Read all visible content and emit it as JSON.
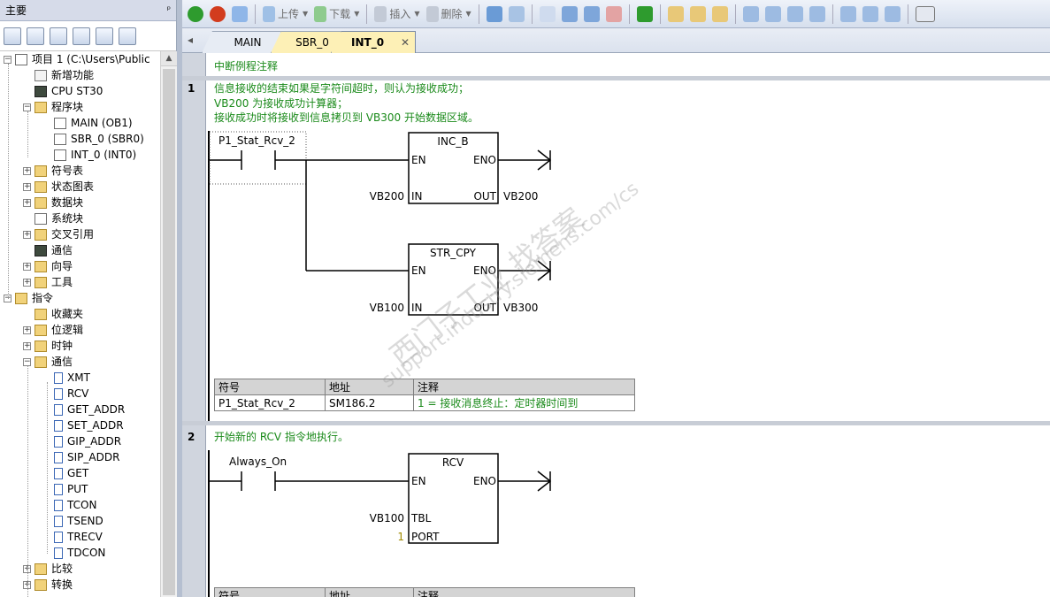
{
  "left_panel": {
    "title": "主要",
    "pin": "ᵖ",
    "tree": [
      {
        "label": "项目 1 (C:\\Users\\Public",
        "level": 0,
        "expander": "−",
        "icon": "project-icon"
      },
      {
        "label": "新增功能",
        "level": 1,
        "expander": "",
        "icon": "whats-new-icon"
      },
      {
        "label": "CPU ST30",
        "level": 1,
        "expander": "",
        "icon": "cpu-icon"
      },
      {
        "label": "程序块",
        "level": 1,
        "expander": "−",
        "icon": "folder-icon"
      },
      {
        "label": "MAIN (OB1)",
        "level": 2,
        "expander": "",
        "icon": "program-block-icon"
      },
      {
        "label": "SBR_0 (SBR0)",
        "level": 2,
        "expander": "",
        "icon": "program-block-icon"
      },
      {
        "label": "INT_0 (INT0)",
        "level": 2,
        "expander": "",
        "icon": "program-block-icon"
      },
      {
        "label": "符号表",
        "level": 1,
        "expander": "+",
        "icon": "folder-icon"
      },
      {
        "label": "状态图表",
        "level": 1,
        "expander": "+",
        "icon": "folder-icon"
      },
      {
        "label": "数据块",
        "level": 1,
        "expander": "+",
        "icon": "folder-icon"
      },
      {
        "label": "系统块",
        "level": 1,
        "expander": "",
        "icon": "system-block-icon"
      },
      {
        "label": "交叉引用",
        "level": 1,
        "expander": "+",
        "icon": "folder-icon"
      },
      {
        "label": "通信",
        "level": 1,
        "expander": "",
        "icon": "communication-icon"
      },
      {
        "label": "向导",
        "level": 1,
        "expander": "+",
        "icon": "wizard-icon"
      },
      {
        "label": "工具",
        "level": 1,
        "expander": "+",
        "icon": "folder-icon"
      },
      {
        "label": "指令",
        "level": 0,
        "expander": "−",
        "icon": "instructions-icon"
      },
      {
        "label": "收藏夹",
        "level": 1,
        "expander": "",
        "icon": "folder-icon"
      },
      {
        "label": "位逻辑",
        "level": 1,
        "expander": "+",
        "icon": "folder-icon"
      },
      {
        "label": "时钟",
        "level": 1,
        "expander": "+",
        "icon": "folder-icon"
      },
      {
        "label": "通信",
        "level": 1,
        "expander": "−",
        "icon": "folder-icon"
      },
      {
        "label": "XMT",
        "level": 2,
        "expander": "",
        "icon": "instruction-icon"
      },
      {
        "label": "RCV",
        "level": 2,
        "expander": "",
        "icon": "instruction-icon"
      },
      {
        "label": "GET_ADDR",
        "level": 2,
        "expander": "",
        "icon": "instruction-icon"
      },
      {
        "label": "SET_ADDR",
        "level": 2,
        "expander": "",
        "icon": "instruction-icon"
      },
      {
        "label": "GIP_ADDR",
        "level": 2,
        "expander": "",
        "icon": "instruction-icon"
      },
      {
        "label": "SIP_ADDR",
        "level": 2,
        "expander": "",
        "icon": "instruction-icon"
      },
      {
        "label": "GET",
        "level": 2,
        "expander": "",
        "icon": "instruction-icon"
      },
      {
        "label": "PUT",
        "level": 2,
        "expander": "",
        "icon": "instruction-icon"
      },
      {
        "label": "TCON",
        "level": 2,
        "expander": "",
        "icon": "instruction-icon"
      },
      {
        "label": "TSEND",
        "level": 2,
        "expander": "",
        "icon": "instruction-icon"
      },
      {
        "label": "TRECV",
        "level": 2,
        "expander": "",
        "icon": "instruction-icon"
      },
      {
        "label": "TDCON",
        "level": 2,
        "expander": "",
        "icon": "instruction-icon"
      },
      {
        "label": "比较",
        "level": 1,
        "expander": "+",
        "icon": "folder-icon"
      },
      {
        "label": "转换",
        "level": 1,
        "expander": "+",
        "icon": "folder-icon"
      }
    ]
  },
  "toolbar": {
    "upload": "上传",
    "download": "下载",
    "insert": "插入",
    "delete": "删除",
    "colors": {
      "run": "#2e9b2e",
      "stop": "#d23c1e",
      "accent": "#2f6fc7"
    }
  },
  "tabs": [
    {
      "label": "MAIN",
      "active": false
    },
    {
      "label": "SBR_0",
      "active": false
    },
    {
      "label": "INT_0",
      "active": true
    }
  ],
  "tab_close": "✕",
  "tab_scroll": "◂",
  "editor": {
    "block_comment": "中断例程注释",
    "networks": [
      {
        "number": "1",
        "comments": [
          "信息接收的结束如果是字符间超时，则认为接收成功；",
          "VB200 为接收成功计算器；",
          "接收成功时将接收到信息拷贝到 VB300 开始数据区域。"
        ],
        "contact": "P1_Stat_Rcv_2",
        "boxes": [
          {
            "name": "INC_B",
            "en": "EN",
            "eno": "ENO",
            "in_pin": "IN",
            "in_val": "VB200",
            "out_pin": "OUT",
            "out_val": "VB200"
          },
          {
            "name": "STR_CPY",
            "en": "EN",
            "eno": "ENO",
            "in_pin": "IN",
            "in_val": "VB100",
            "out_pin": "OUT",
            "out_val": "VB300"
          }
        ],
        "symbol_table": {
          "headers": [
            "符号",
            "地址",
            "注释"
          ],
          "rows": [
            [
              "P1_Stat_Rcv_2",
              "SM186.2",
              "1 = 接收消息终止：定时器时间到"
            ]
          ]
        }
      },
      {
        "number": "2",
        "comments": [
          "开始新的 RCV 指令地执行。"
        ],
        "contact": "Always_On",
        "box": {
          "name": "RCV",
          "en": "EN",
          "eno": "ENO",
          "tbl_pin": "TBL",
          "tbl_val": "VB100",
          "port_pin": "PORT",
          "port_val": "1"
        },
        "symbol_table": {
          "headers": [
            "符号",
            "地址",
            "注释"
          ]
        }
      }
    ]
  },
  "watermark": {
    "line1": "西门子工业 找答案",
    "line2": "support.industry.siemens.com/cs"
  }
}
